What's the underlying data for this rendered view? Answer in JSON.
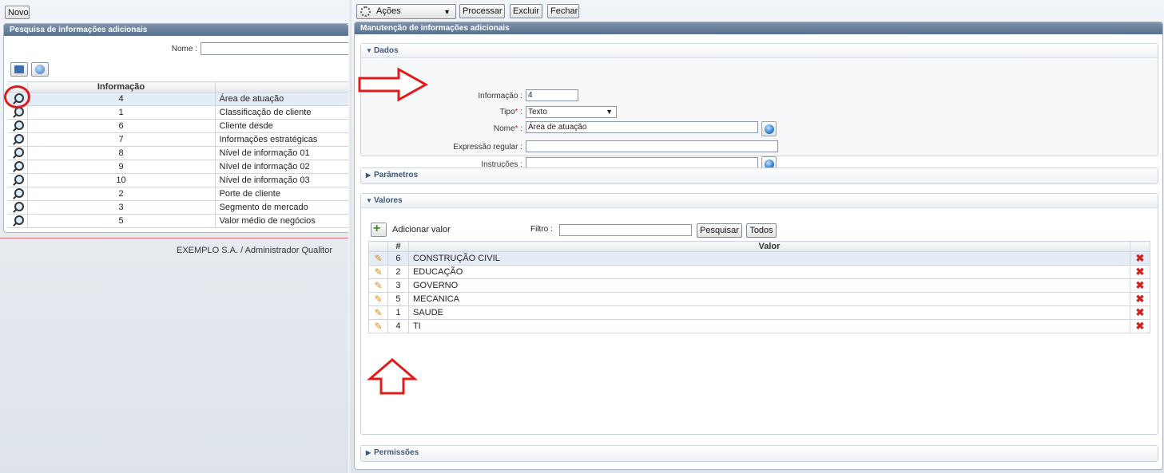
{
  "left": {
    "new_button": "Novo",
    "panel_title": "Pesquisa de informações adicionais",
    "name_label": "Nome :",
    "table": {
      "headers": [
        "Informação",
        ""
      ],
      "rows": [
        {
          "num": "4",
          "desc": "Área de atuação"
        },
        {
          "num": "1",
          "desc": "Classificação de cliente"
        },
        {
          "num": "6",
          "desc": "Cliente desde"
        },
        {
          "num": "7",
          "desc": "Informações estratégicas"
        },
        {
          "num": "8",
          "desc": "Nível de informação 01"
        },
        {
          "num": "9",
          "desc": "Nível de informação 02"
        },
        {
          "num": "10",
          "desc": "Nível de informação 03"
        },
        {
          "num": "2",
          "desc": "Porte de cliente"
        },
        {
          "num": "3",
          "desc": "Segmento de mercado"
        },
        {
          "num": "5",
          "desc": "Valor médio de negócios"
        }
      ]
    },
    "footer": "EXEMPLO S.A. / Administrador Qualitor"
  },
  "toolbar": {
    "actions": "Ações",
    "process": "Processar",
    "delete": "Excluir",
    "close": "Fechar"
  },
  "right": {
    "panel_title": "Manutenção de informações adicionais",
    "dados": {
      "title": "Dados",
      "info_label": "Informação :",
      "info_value": "4",
      "type_label": "Tipo",
      "type_value": "Texto",
      "name_label": "Nome",
      "name_value": "Área de atuação",
      "regex_label": "Expressão regular :",
      "instr_label": "Instruções :",
      "label_suffix": " :",
      "required_mark": "*"
    },
    "parametros_title": "Parâmetros",
    "valores": {
      "title": "Valores",
      "add_label": "Adicionar valor",
      "filter_label": "Filtro :",
      "search_button": "Pesquisar",
      "all_button": "Todos",
      "headers": {
        "num": "#",
        "value": "Valor"
      },
      "rows": [
        {
          "num": "6",
          "value": "CONSTRUÇÃO CIVIL"
        },
        {
          "num": "2",
          "value": "EDUCAÇÃO"
        },
        {
          "num": "3",
          "value": "GOVERNO"
        },
        {
          "num": "5",
          "value": "MECANICA"
        },
        {
          "num": "1",
          "value": "SAUDE"
        },
        {
          "num": "4",
          "value": "TI"
        }
      ]
    },
    "permissoes_title": "Permissões"
  },
  "colors": {
    "annotation": "#e01b1b",
    "panel_header": "#5e7794"
  }
}
